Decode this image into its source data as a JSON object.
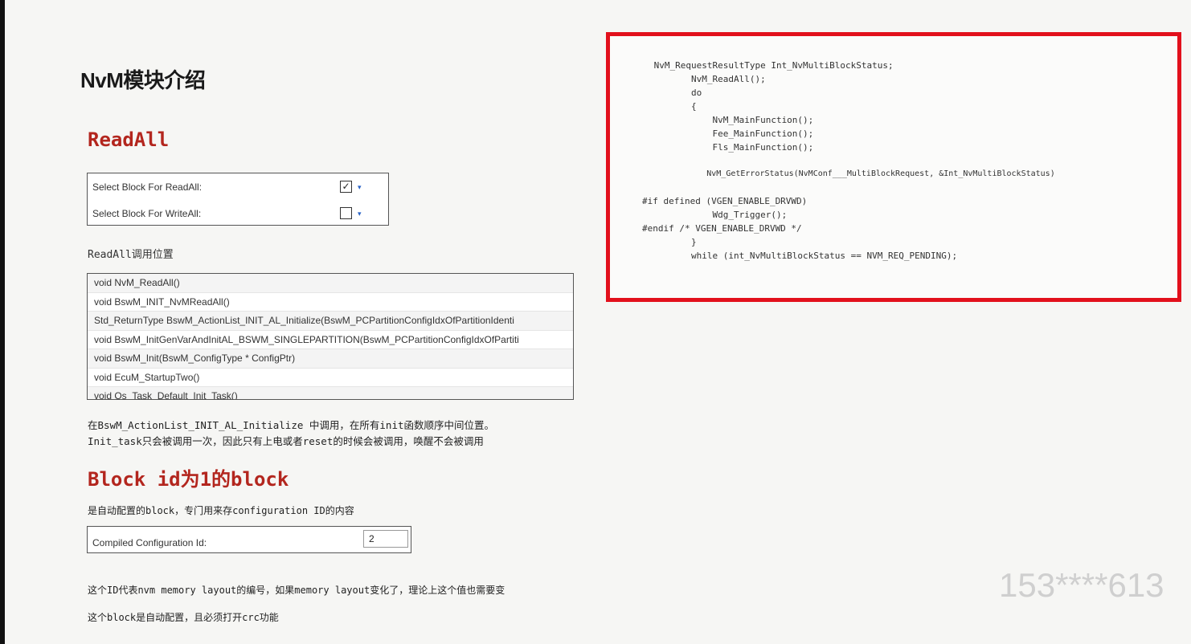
{
  "title": "NvM模块介绍",
  "readall_section": {
    "heading": "ReadAll",
    "options": [
      {
        "label": "Select Block For ReadAll:",
        "checked_glyph": "✓",
        "caret": "▾"
      },
      {
        "label": "Select Block For WriteAll:",
        "checked_glyph": "",
        "caret": "▾"
      }
    ],
    "call_location_label": "ReadAll调用位置",
    "call_stack": [
      "void NvM_ReadAll()",
      "void BswM_INIT_NvMReadAll()",
      "Std_ReturnType BswM_ActionList_INIT_AL_Initialize(BswM_PCPartitionConfigIdxOfPartitionIdenti",
      "void BswM_InitGenVarAndInitAL_BSWM_SINGLEPARTITION(BswM_PCPartitionConfigIdxOfPartiti",
      "void BswM_Init(BswM_ConfigType * ConfigPtr)",
      "void EcuM_StartupTwo()",
      "void Os_Task_Default_Init_Task()"
    ],
    "note_line1": "在BswM_ActionList_INIT_AL_Initialize 中调用，在所有init函数顺序中间位置。",
    "note_line2": "Init_task只会被调用一次，因此只有上电或者reset的时候会被调用，唤醒不会被调用"
  },
  "block1_section": {
    "heading": "Block id为1的block",
    "description": "是自动配置的block，专门用来存configuration ID的内容",
    "field_label": "Compiled Configuration Id:",
    "field_value": "2",
    "note_line1": "这个ID代表nvm memory layout的编号，如果memory layout变化了，理论上这个值也需要变",
    "note_line2": "这个block是自动配置，且必须打开crc功能"
  },
  "code_snippet": [
    " NvM_RequestResultType Int_NvMultiBlockStatus;",
    "        NvM_ReadAll();",
    "        do",
    "        {",
    "            NvM_MainFunction();",
    "            Fee_MainFunction();",
    "            Fls_MainFunction();",
    "",
    "            NvM_GetErrorStatus(NvMConf___MultiBlockRequest, &Int_NvMultiBlockStatus)",
    "#if defined (VGEN_ENABLE_DRVWD)",
    "            Wdg_Trigger();",
    "#endif /* VGEN_ENABLE_DRVWD */",
    "        }",
    "        while (int_NvMultiBlockStatus == NVM_REQ_PENDING);"
  ],
  "watermark": "153****613",
  "colors": {
    "heading_red": "#b3261e",
    "highlight_border": "#e2101c",
    "caret_blue": "#2a63c6"
  }
}
